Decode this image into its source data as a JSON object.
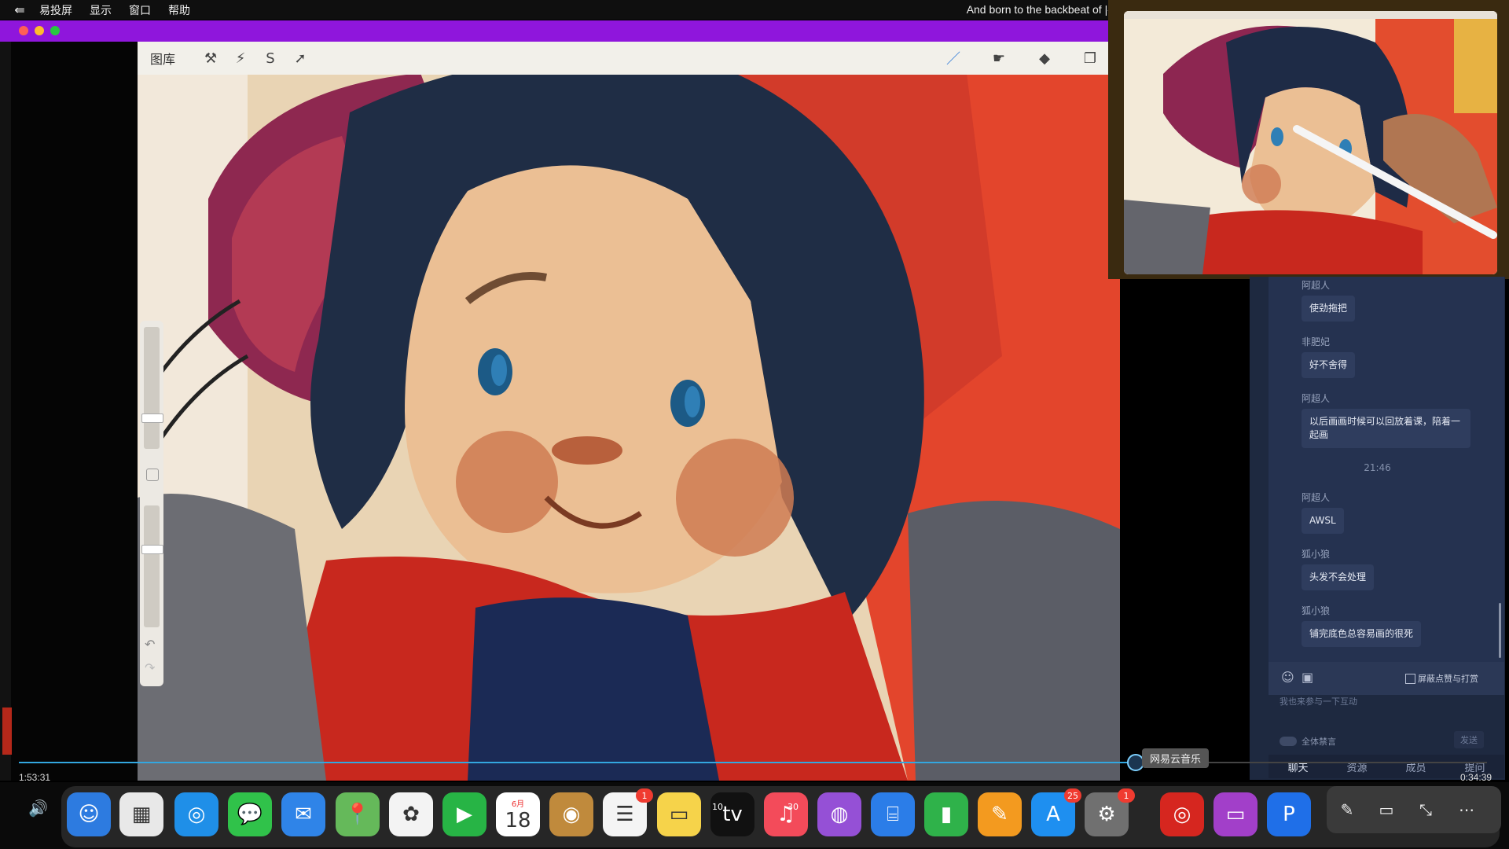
{
  "menubar": {
    "app_name": "易投屏",
    "items": [
      "显示",
      "窗口",
      "帮助"
    ],
    "now_playing": "And born to the backbeat of |◀"
  },
  "procreate": {
    "gallery_label": "图库",
    "left_tools": [
      "wrench-icon",
      "magic-wand-icon",
      "selection-icon",
      "transform-icon"
    ],
    "right_tools": [
      "brush-icon",
      "smudge-icon",
      "eraser-icon",
      "layers-icon"
    ]
  },
  "chat": {
    "messages": [
      {
        "user": "阿超人",
        "text": "使劲拖把"
      },
      {
        "user": "非肥妃",
        "text": "好不舍得"
      },
      {
        "user": "阿超人",
        "text": "以后画画时候可以回放着课，陪着一起画"
      },
      {
        "timestamp": "21:46"
      },
      {
        "user": "阿超人",
        "text": "AWSL"
      },
      {
        "user": "狐小狼",
        "text": "头发不会处理"
      },
      {
        "user": "狐小狼",
        "text": "铺完底色总容易画的很死"
      }
    ],
    "checkbox_label": "屏蔽点赞与打赏",
    "input_placeholder": "我也来参与一下互动",
    "mute_all_label": "全体禁言",
    "send_label": "发送",
    "tabs": [
      "聊天",
      "资源",
      "成员",
      "提问"
    ]
  },
  "player": {
    "elapsed": "1:53:31",
    "remaining": "0:34:39",
    "progress_fraction": 0.76,
    "tooltip": "网易云音乐"
  },
  "dock": {
    "apps": [
      {
        "name": "finder",
        "glyph": "☺",
        "color": "#2d7be0"
      },
      {
        "name": "launchpad",
        "glyph": "▦",
        "color": "#e8e8e8"
      },
      {
        "name": "safari",
        "glyph": "◎",
        "color": "#1f8fe8"
      },
      {
        "name": "messages",
        "glyph": "💬",
        "color": "#30c24a"
      },
      {
        "name": "mail",
        "glyph": "✉",
        "color": "#2f84e8"
      },
      {
        "name": "maps",
        "glyph": "📍",
        "color": "#65b95a"
      },
      {
        "name": "photos",
        "glyph": "✿",
        "color": "#f3f3f3"
      },
      {
        "name": "facetime",
        "glyph": "▶",
        "color": "#27b445"
      },
      {
        "name": "calendar",
        "glyph": "18",
        "month": "6月",
        "color": "#ffffff"
      },
      {
        "name": "contacts",
        "glyph": "◉",
        "color": "#c08a3c"
      },
      {
        "name": "reminders",
        "glyph": "☰",
        "color": "#f4f4f4",
        "badge": "1"
      },
      {
        "name": "notes",
        "glyph": "▭",
        "color": "#f6d34a"
      },
      {
        "name": "apple-tv",
        "glyph": "tv",
        "color": "#111111"
      },
      {
        "name": "music",
        "glyph": "♫",
        "color": "#f34b5a"
      },
      {
        "name": "podcasts",
        "glyph": "◍",
        "color": "#9550d6"
      },
      {
        "name": "keynote",
        "glyph": "⌸",
        "color": "#2b7de8"
      },
      {
        "name": "numbers",
        "glyph": "▮",
        "color": "#2fb24a"
      },
      {
        "name": "pages",
        "glyph": "✎",
        "color": "#f39a1f"
      },
      {
        "name": "app-store",
        "glyph": "A",
        "color": "#1e8ff0",
        "badge": "25"
      },
      {
        "name": "system-preferences",
        "glyph": "⚙",
        "color": "#707070",
        "badge": "1"
      },
      {
        "name": "netease-music",
        "glyph": "◎",
        "color": "#d6261f"
      },
      {
        "name": "screen-mirror",
        "glyph": "▭",
        "color": "#a23fc9"
      },
      {
        "name": "p-app",
        "glyph": "P",
        "color": "#1f6fe8"
      }
    ],
    "skip_back": "10",
    "skip_fwd": "30"
  },
  "controls": [
    "pencil-icon",
    "pip-icon",
    "collapse-icon",
    "more-icon"
  ]
}
